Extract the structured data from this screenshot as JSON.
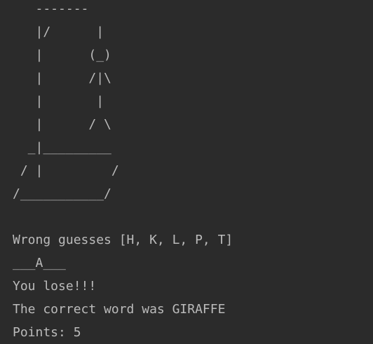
{
  "console": {
    "gallows": [
      "   -------",
      "   |/      |",
      "   |      (_)",
      "   |      /|\\",
      "   |       |",
      "   |      / \\",
      "  _|_________",
      " / |         /",
      "/___________/"
    ],
    "blank": "",
    "wrong_guesses": "Wrong guesses [H, K, L, P, T]",
    "masked_word": "___A___",
    "result": "You lose!!!",
    "correct_word": "The correct word was GIRAFFE",
    "points": "Points: 5"
  }
}
